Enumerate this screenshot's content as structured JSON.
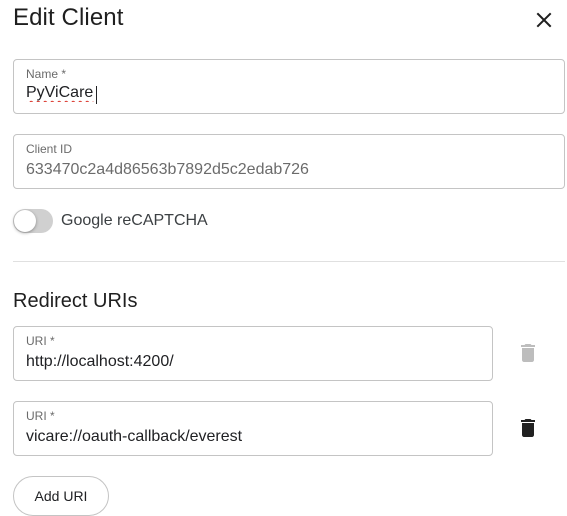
{
  "dialog": {
    "title": "Edit Client",
    "close_icon": "close-icon"
  },
  "name_field": {
    "label": "Name *",
    "value": "PyViCare"
  },
  "client_id_field": {
    "label": "Client ID",
    "value": "633470c2a4d86563b7892d5c2edab726"
  },
  "recaptcha": {
    "label": "Google reCAPTCHA",
    "enabled": false
  },
  "redirect": {
    "heading": "Redirect URIs",
    "uris": [
      {
        "label": "URI *",
        "value": "http://localhost:4200/",
        "delete_enabled": false
      },
      {
        "label": "URI *",
        "value": "vicare://oauth-callback/everest",
        "delete_enabled": true
      }
    ],
    "add_label": "Add URI"
  },
  "colors": {
    "text": "#202124",
    "border": "#c4c4c4",
    "icon_disabled": "#bdbdbd",
    "icon_active": "#212121"
  }
}
